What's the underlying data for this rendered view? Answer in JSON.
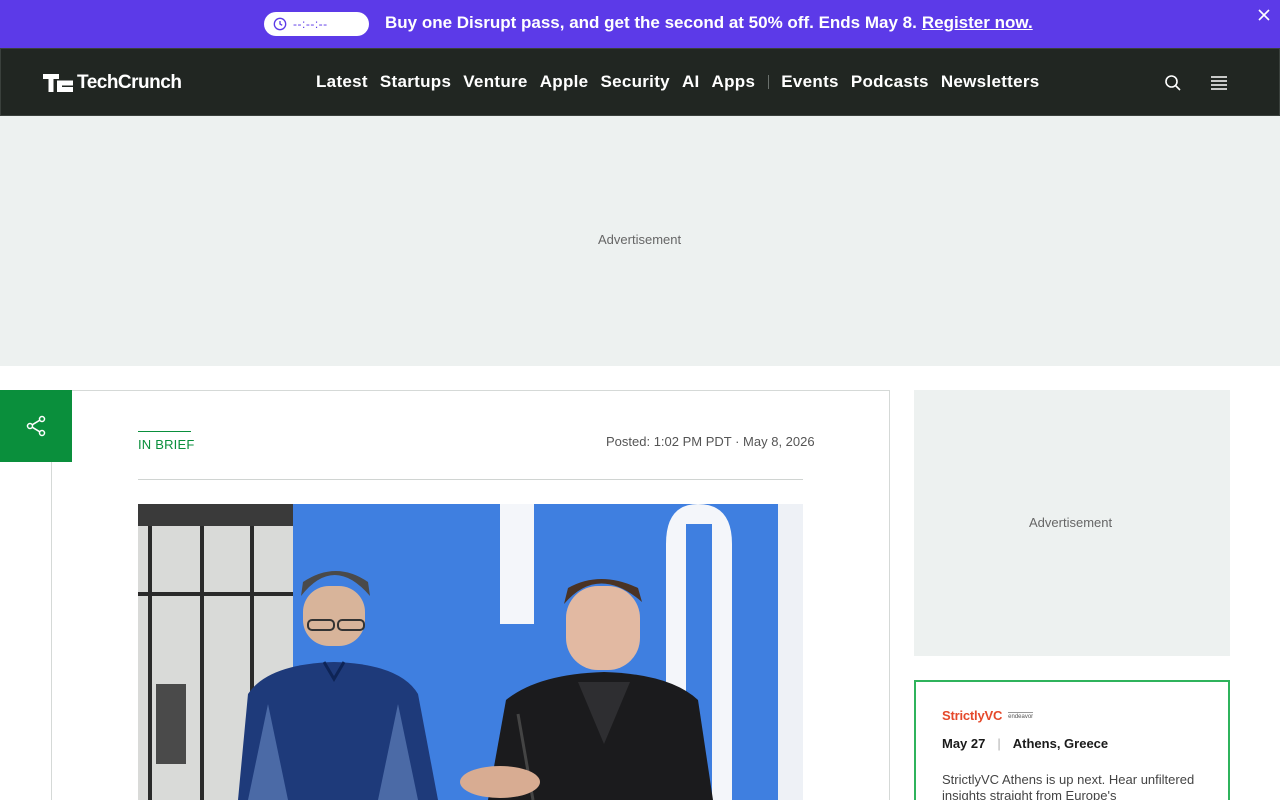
{
  "promo": {
    "timer": "--:--:--",
    "text": "Buy one Disrupt pass, and get the second at 50% off. Ends May 8.",
    "link": "Register now.",
    "bg_color": "#5c3ae8"
  },
  "nav": {
    "logo_text": "TechCrunch",
    "links": [
      "Latest",
      "Startups",
      "Venture",
      "Apple",
      "Security",
      "AI",
      "Apps"
    ],
    "links_right": [
      "Events",
      "Podcasts",
      "Newsletters"
    ]
  },
  "ads": {
    "top_label": "Advertisement",
    "side_label": "Advertisement"
  },
  "article": {
    "category": "IN BRIEF",
    "posted": "Posted: 1:02 PM PDT · May 8, 2026",
    "accent_color": "#0a8f3c"
  },
  "event": {
    "brand": "StrictlyVC",
    "partner": "endeavor",
    "date": "May 27",
    "location": "Athens, Greece",
    "description": "StrictlyVC Athens is up next. Hear unfiltered insights straight from Europe's"
  }
}
